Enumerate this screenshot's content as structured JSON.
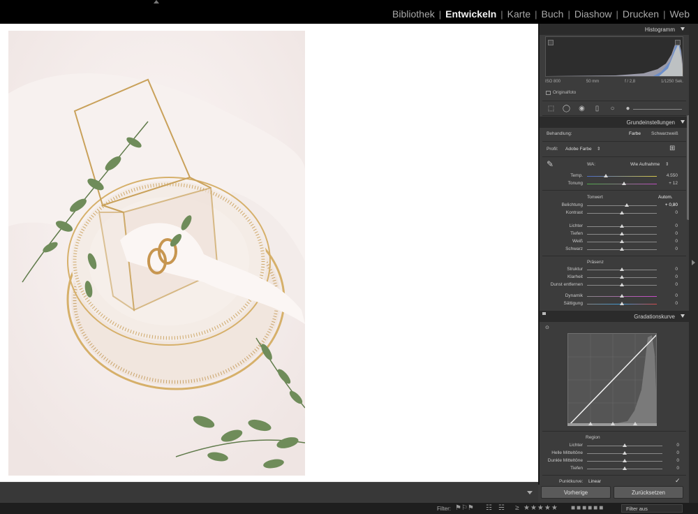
{
  "modules": [
    "Bibliothek",
    "Entwickeln",
    "Karte",
    "Buch",
    "Diashow",
    "Drucken",
    "Web"
  ],
  "active_module": "Entwickeln",
  "histogram": {
    "title": "Histogramm",
    "iso": "ISO 800",
    "focal": "50 mm",
    "aperture": "f / 2,8",
    "shutter": "1/1250 Sek.",
    "original_label": "Originalfoto"
  },
  "basic": {
    "title": "Grundeinstellungen",
    "treatment_label": "Behandlung:",
    "treatment_color": "Farbe",
    "treatment_bw": "Schwarzweiß",
    "profile_label": "Profil:",
    "profile_value": "Adobe Farbe",
    "wb_label": "WA:",
    "wb_value": "Wie Aufnahme",
    "temp_label": "Temp.",
    "temp_value": "4.550",
    "tint_label": "Tonung",
    "tint_value": "+ 12",
    "tone_label": "Tonwert",
    "auto_label": "Autom.",
    "exposure_label": "Belichtung",
    "exposure_value": "+ 0,80",
    "contrast_label": "Kontrast",
    "contrast_value": "0",
    "highlights_label": "Lichter",
    "highlights_value": "0",
    "shadows_label": "Tiefen",
    "shadows_value": "0",
    "whites_label": "Weiß",
    "whites_value": "0",
    "blacks_label": "Schwarz",
    "blacks_value": "0",
    "presence_label": "Präsenz",
    "texture_label": "Struktur",
    "texture_value": "0",
    "clarity_label": "Klarheit",
    "clarity_value": "0",
    "dehaze_label": "Dunst entfernen",
    "dehaze_value": "0",
    "vibrance_label": "Dynamik",
    "vibrance_value": "0",
    "saturation_label": "Sättigung",
    "saturation_value": "0"
  },
  "curve": {
    "title": "Gradationskurve",
    "region_label": "Region",
    "r_highlights_label": "Lichter",
    "r_highlights_value": "0",
    "r_lights_label": "Helle Mitteltöne",
    "r_lights_value": "0",
    "r_darks_label": "Dunkle Mitteltöne",
    "r_darks_value": "0",
    "r_shadows_label": "Tiefen",
    "r_shadows_value": "0",
    "pointcurve_label": "Punktkurve:",
    "pointcurve_value": "Linear"
  },
  "buttons": {
    "previous": "Vorherige",
    "reset": "Zurücksetzen"
  },
  "filter": {
    "label": "Filter:",
    "select_value": "Filter aus"
  }
}
